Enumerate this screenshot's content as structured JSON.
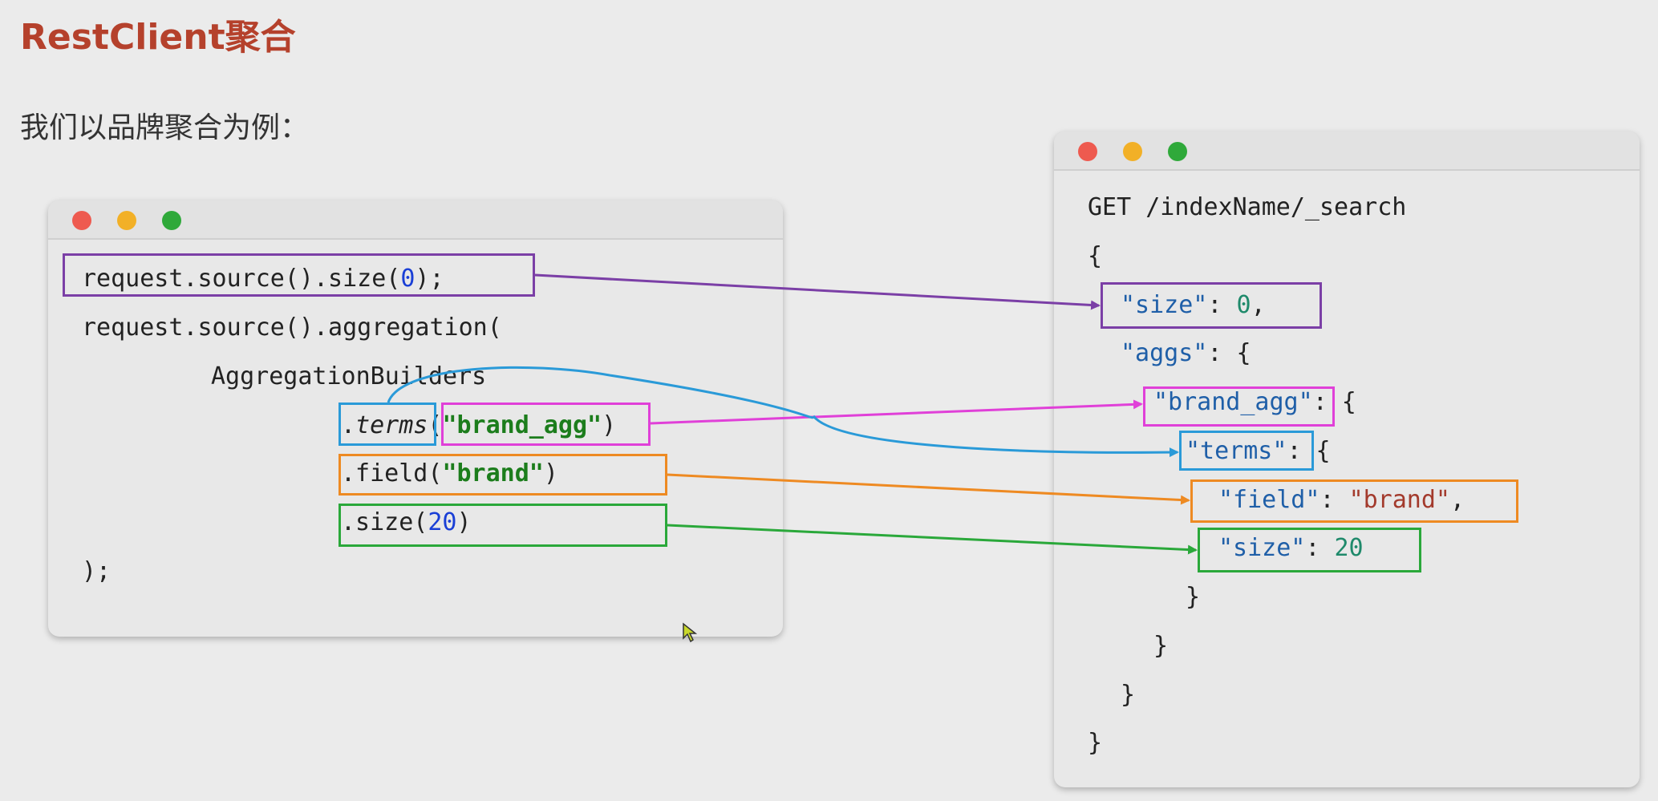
{
  "heading": "RestClient聚合",
  "intro": "我们以品牌聚合为例：",
  "left_code": {
    "line1": {
      "a": "request.source().size(",
      "n": "0",
      "b": ");"
    },
    "line2": "request.source().aggregation(",
    "line3": "AggregationBuilders",
    "line4": {
      "a": ".",
      "m": "terms",
      "b": "(",
      "s": "\"brand_agg\"",
      "c": ")"
    },
    "line5": {
      "a": ".field(",
      "s": "\"brand\"",
      "b": ")"
    },
    "line6": {
      "a": ".size(",
      "n": "20",
      "b": ")"
    },
    "line7": ");"
  },
  "right_code": {
    "line1": "GET /indexName/_search",
    "line2": "{",
    "line3": {
      "k": "\"size\"",
      "sep": ": ",
      "v": "0",
      "end": ","
    },
    "line4": {
      "k": "\"aggs\"",
      "sep": ": {"
    },
    "line5": {
      "k": "\"brand_agg\"",
      "sep": ": {"
    },
    "line6": {
      "k": "\"terms\"",
      "sep": ": {"
    },
    "line7": {
      "k": "\"field\"",
      "sep": ": ",
      "v": "\"brand\"",
      "end": ","
    },
    "line8": {
      "k": "\"size\"",
      "sep": ": ",
      "v": "20"
    },
    "line9": "}",
    "line10": "}",
    "line11": "}",
    "line12": "}"
  },
  "colors": {
    "purple": "#7b3fa6",
    "magenta": "#e040d8",
    "blue": "#2a9ad8",
    "orange": "#ee8a22",
    "green": "#2aa83a",
    "dot_red": "#ee5a4f",
    "dot_yellow": "#f2b027",
    "dot_green": "#2fa93a"
  }
}
